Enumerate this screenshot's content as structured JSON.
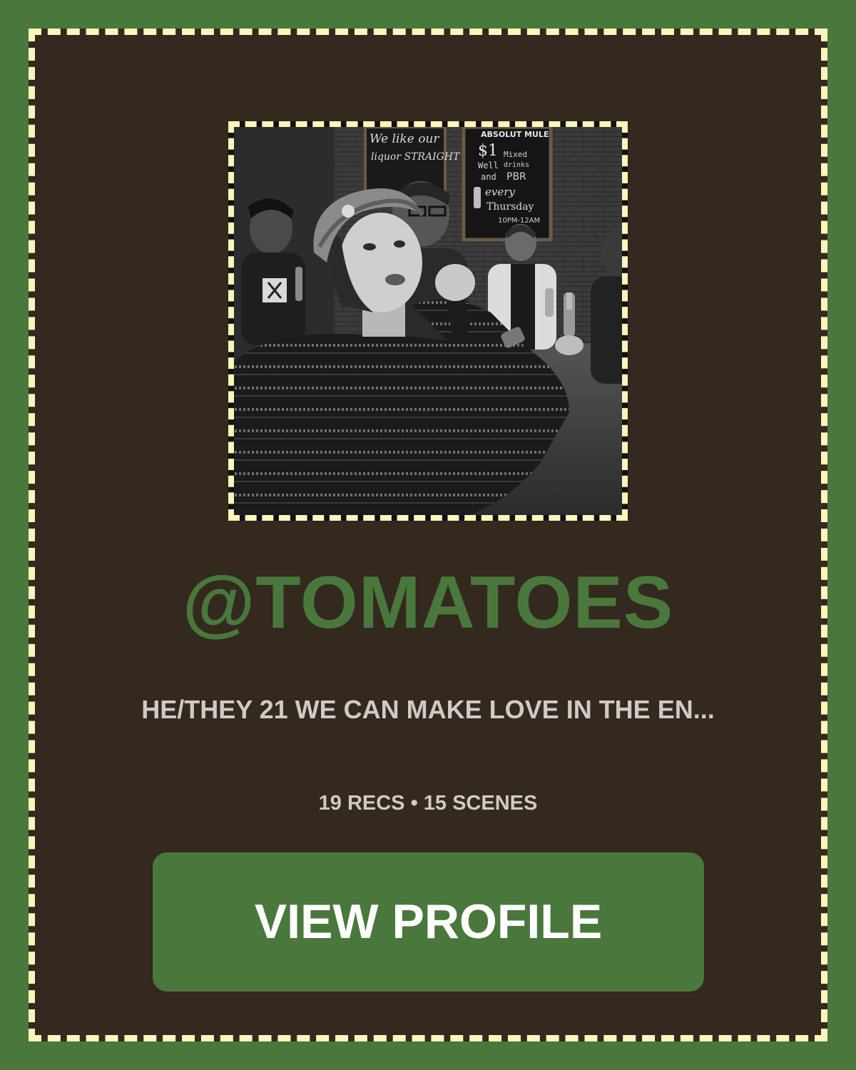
{
  "profile": {
    "username": "@TOMATOES",
    "bio": "HE/THEY 21 WE CAN MAKE LOVE IN THE EN...",
    "stats": "19 RECS • 15 SCENES",
    "button_label": "VIEW PROFILE"
  },
  "photo_signs": {
    "left_sign_line1": "We like our",
    "left_sign_line2": "liquor STRAIGHT",
    "right_sign_title": "ABSOLUT MULE",
    "right_sign_price": "$1",
    "right_sign_well": "Well",
    "right_sign_mixed": "Mixed",
    "right_sign_drinks": "drinks",
    "right_sign_and": "and",
    "right_sign_pbr": "PBR",
    "right_sign_every": "every",
    "right_sign_thursday": "Thursday",
    "right_sign_time": "10PM-12AM"
  },
  "colors": {
    "background_green": "#4a773c",
    "card_brown": "#33291f",
    "dashed_border": "#fbf6bd",
    "muted_text": "#cfcac6",
    "button_text": "#ffffff"
  }
}
